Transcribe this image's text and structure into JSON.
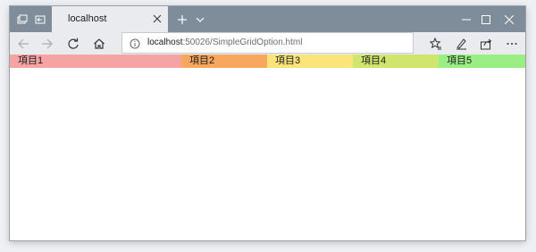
{
  "browser": {
    "tab_title": "localhost",
    "url_host": "localhost",
    "url_rest": ":50026/SimpleGridOption.html"
  },
  "grid": {
    "cells": [
      {
        "label": "項目1",
        "color": "#f6a3a3"
      },
      {
        "label": "項目2",
        "color": "#f8a75e"
      },
      {
        "label": "項目3",
        "color": "#fbe57a"
      },
      {
        "label": "項目4",
        "color": "#cfe56e"
      },
      {
        "label": "項目5",
        "color": "#99ef83"
      }
    ]
  },
  "icons": [
    "tab-manager-icon",
    "set-aside-tabs-icon",
    "close-icon",
    "new-tab-icon",
    "chevron-down-icon",
    "minimize-icon",
    "maximize-icon",
    "close-window-icon",
    "back-icon",
    "forward-icon",
    "refresh-icon",
    "home-icon",
    "info-icon",
    "favorites-icon",
    "notes-icon",
    "share-icon",
    "more-icon"
  ]
}
